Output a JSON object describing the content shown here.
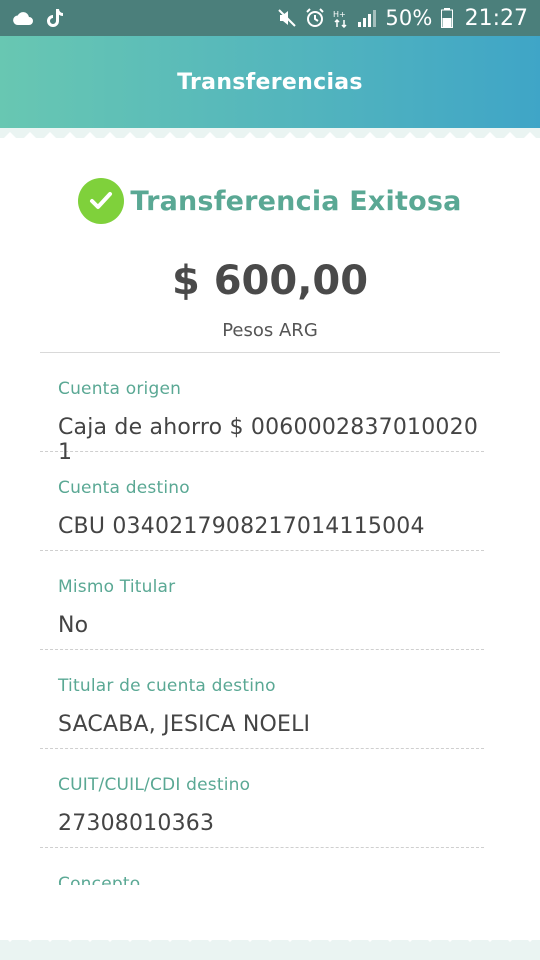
{
  "status_bar": {
    "left_icons": [
      "cloud-icon",
      "tiktok-icon"
    ],
    "right_icons": [
      "mute-icon",
      "alarm-icon",
      "data-transfer-icon",
      "signal-icon",
      "battery-icon"
    ],
    "battery_percent": "50%",
    "time": "21:27"
  },
  "header": {
    "title": "Transferencias",
    "gradient_colors": [
      "#68c7b2",
      "#3fa5c7"
    ]
  },
  "result": {
    "icon": "checkmark-circle-icon",
    "status_text": "Transferencia Exitosa",
    "amount": "$ 600,00",
    "currency": "Pesos ARG"
  },
  "details": [
    {
      "label": "Cuenta origen",
      "value": "Caja de ahorro $ 0060002837010020​1"
    },
    {
      "label": "Cuenta destino",
      "value": "CBU 0340217908217014115004"
    },
    {
      "label": "Mismo Titular",
      "value": "No"
    },
    {
      "label": "Titular de cuenta destino",
      "value": "SACABA, JESICA NOELI"
    },
    {
      "label": "CUIT/CUIL/CDI destino",
      "value": "27308010363"
    },
    {
      "label": "Concepto",
      "value": ""
    }
  ],
  "colors": {
    "accent": "#5aa894",
    "success": "#7fd13b",
    "status_bar": "#4b7f7b",
    "text_dark": "#444444"
  }
}
